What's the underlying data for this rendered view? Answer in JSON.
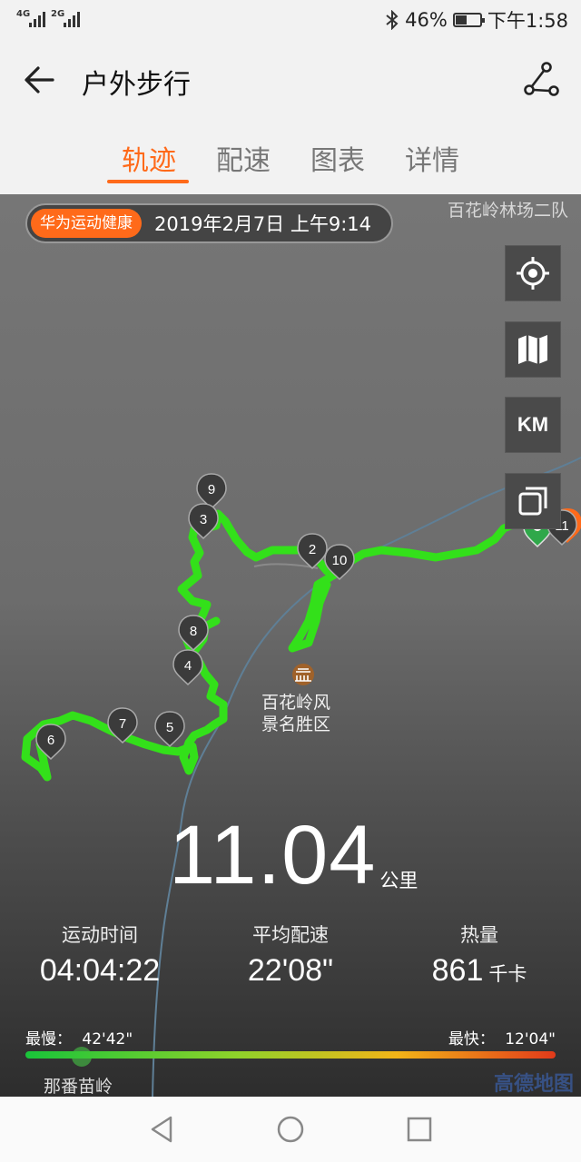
{
  "status_bar": {
    "net1": "4G",
    "net2": "2G",
    "battery_percent": "46%",
    "battery_level": 0.46,
    "time": "下午1:58",
    "bluetooth_icon": "bluetooth-icon"
  },
  "header": {
    "title": "户外步行",
    "back_icon": "arrow-left-icon",
    "route_icon": "route-share-icon"
  },
  "tabs": [
    {
      "label": "轨迹",
      "active": true
    },
    {
      "label": "配速",
      "active": false
    },
    {
      "label": "图表",
      "active": false
    },
    {
      "label": "详情",
      "active": false
    }
  ],
  "map": {
    "brand_label": "华为运动健康",
    "date_time": "2019年2月7日 上午9:14",
    "place_top_right": "百花岭林场二队",
    "place_scenic_line1": "百花岭风",
    "place_scenic_line2": "景名胜区",
    "place_bottom": "那番苗岭",
    "map_provider": "高德地图",
    "km_button_label": "KM",
    "track_color": "#33e01a",
    "markers": [
      "2",
      "3",
      "4",
      "5",
      "6",
      "7",
      "8",
      "9",
      "10",
      "11"
    ]
  },
  "summary": {
    "distance_value": "11.04",
    "distance_unit": "公里",
    "stats": [
      {
        "label": "运动时间",
        "value": "04:04:22",
        "unit": ""
      },
      {
        "label": "平均配速",
        "value": "22'08\"",
        "unit": ""
      },
      {
        "label": "热量",
        "value": "861",
        "unit": "千卡"
      }
    ],
    "slowest_label": "最慢：",
    "slowest_value": "42'42\"",
    "fastest_label": "最快：",
    "fastest_value": "12'04\""
  },
  "colors": {
    "accent": "#ff6a1a"
  }
}
